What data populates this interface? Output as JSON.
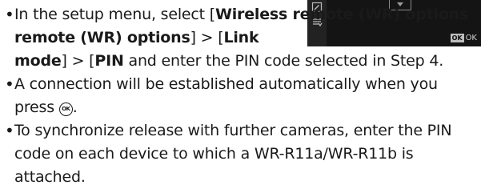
{
  "screen": {
    "ok_badge": "OK",
    "ok_label": "OK",
    "icons": [
      "pencil-icon",
      "retouch-icon"
    ]
  },
  "bullets": [
    {
      "parts": [
        "In the setup menu, select [",
        "Wireless remote (WR) options",
        "] > [",
        "Link mode",
        "] > [",
        "PIN",
        "] and enter the PIN code selected in Step 4."
      ]
    },
    {
      "text_a": "A connection will be established automatically when you press ",
      "ok_glyph": "OK",
      "text_b": "."
    },
    {
      "text": "To synchronize release with further cameras, enter the PIN code on each device to which a WR-R11a/WR-R11b is attached."
    }
  ],
  "bullet_char": "•"
}
